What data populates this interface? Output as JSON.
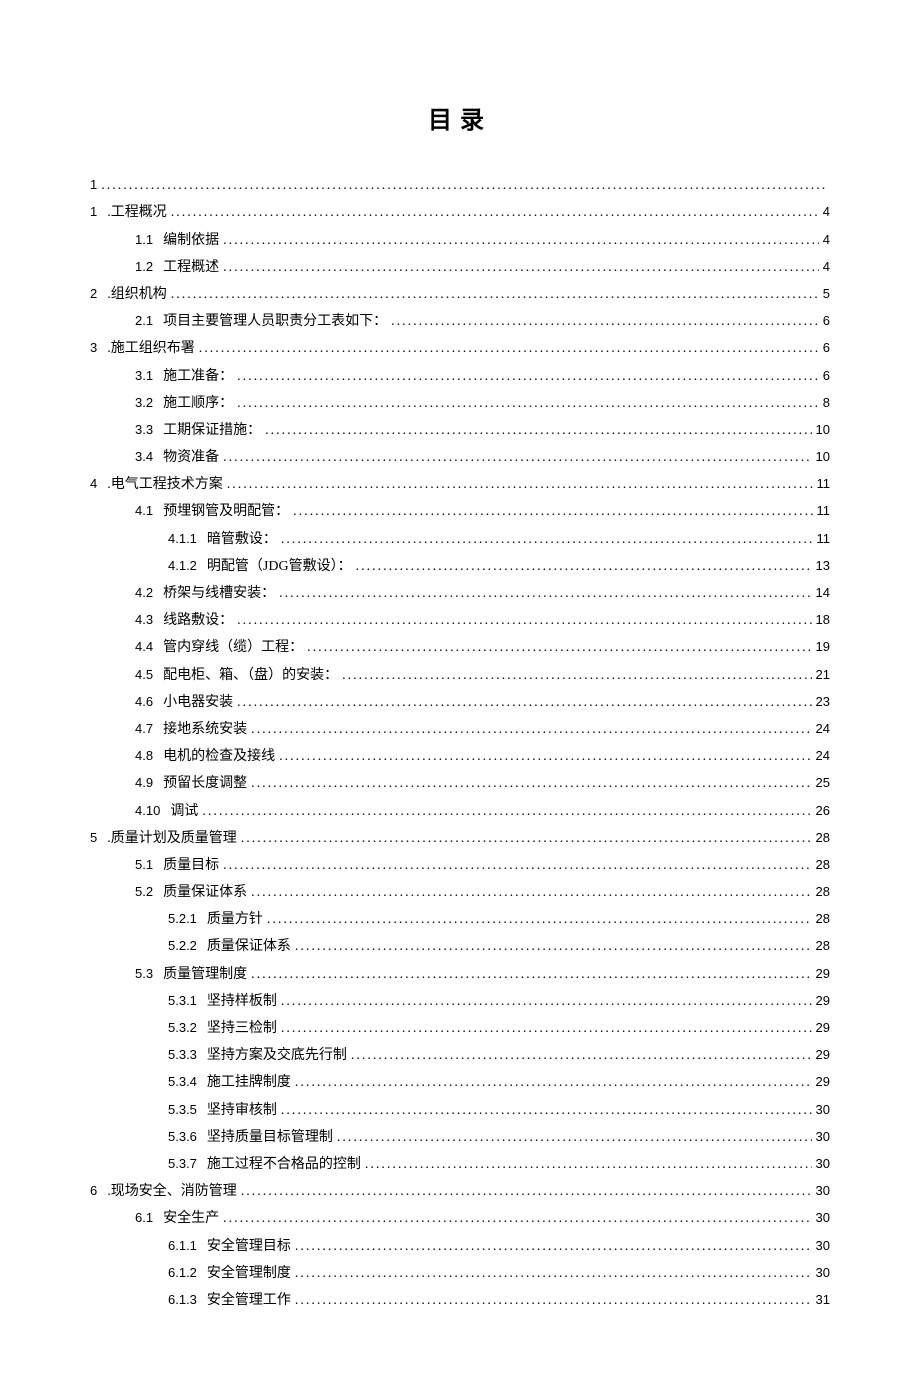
{
  "title": "目录",
  "entries": [
    {
      "indent": 0,
      "num": "1",
      "text": "",
      "page": ""
    },
    {
      "indent": 0,
      "num": "1",
      "text": ".工程概况",
      "page": "4"
    },
    {
      "indent": 1,
      "num": "1.1",
      "text": "编制依据",
      "page": "4"
    },
    {
      "indent": 1,
      "num": "1.2",
      "text": "工程概述",
      "page": "4"
    },
    {
      "indent": 0,
      "num": "2",
      "text": ".组织机构",
      "page": "5"
    },
    {
      "indent": 1,
      "num": "2.1",
      "text": "项目主要管理人员职责分工表如下：",
      "page": "6"
    },
    {
      "indent": 0,
      "num": "3",
      "text": ".施工组织布署",
      "page": "6"
    },
    {
      "indent": 1,
      "num": "3.1",
      "text": "施工准备：",
      "page": "6"
    },
    {
      "indent": 1,
      "num": "3.2",
      "text": "施工顺序：",
      "page": "8"
    },
    {
      "indent": 1,
      "num": "3.3",
      "text": "工期保证措施：",
      "page": "10"
    },
    {
      "indent": 1,
      "num": "3.4",
      "text": "物资准备",
      "page": "10"
    },
    {
      "indent": 0,
      "num": "4",
      "text": ".电气工程技术方案",
      "page": "11"
    },
    {
      "indent": 1,
      "num": "4.1",
      "text": "预埋钢管及明配管：",
      "page": "11"
    },
    {
      "indent": 2,
      "num": "4.1.1",
      "text": "暗管敷设：",
      "page": "11"
    },
    {
      "indent": 2,
      "num": "4.1.2",
      "text": "明配管（JDG管敷设）：",
      "page": "13"
    },
    {
      "indent": 1,
      "num": "4.2",
      "text": "桥架与线槽安装：",
      "page": "14"
    },
    {
      "indent": 1,
      "num": "4.3",
      "text": "线路敷设：",
      "page": "18"
    },
    {
      "indent": 1,
      "num": "4.4",
      "text": "管内穿线（缆）工程：",
      "page": "19"
    },
    {
      "indent": 1,
      "num": "4.5",
      "text": "配电柜、箱、（盘）的安装：",
      "page": "21"
    },
    {
      "indent": 1,
      "num": "4.6",
      "text": "小电器安装",
      "page": "23"
    },
    {
      "indent": 1,
      "num": "4.7",
      "text": "接地系统安装",
      "page": "24"
    },
    {
      "indent": 1,
      "num": "4.8",
      "text": "电机的检查及接线",
      "page": "24"
    },
    {
      "indent": 1,
      "num": "4.9",
      "text": "预留长度调整",
      "page": "25"
    },
    {
      "indent": 1,
      "num": "4.10",
      "text": "调试",
      "page": "26"
    },
    {
      "indent": 0,
      "num": "5",
      "text": ".质量计划及质量管理",
      "page": "28"
    },
    {
      "indent": 1,
      "num": "5.1",
      "text": "质量目标",
      "page": "28"
    },
    {
      "indent": 1,
      "num": "5.2",
      "text": "质量保证体系",
      "page": "28"
    },
    {
      "indent": 2,
      "num": "5.2.1",
      "text": "质量方针",
      "page": "28"
    },
    {
      "indent": 2,
      "num": "5.2.2",
      "text": "质量保证体系",
      "page": "28"
    },
    {
      "indent": 1,
      "num": "5.3",
      "text": "质量管理制度",
      "page": "29"
    },
    {
      "indent": 2,
      "num": "5.3.1",
      "text": "坚持样板制",
      "page": "29"
    },
    {
      "indent": 2,
      "num": "5.3.2",
      "text": "坚持三检制",
      "page": "29"
    },
    {
      "indent": 2,
      "num": "5.3.3",
      "text": "坚持方案及交底先行制",
      "page": "29"
    },
    {
      "indent": 2,
      "num": "5.3.4",
      "text": "施工挂牌制度",
      "page": "29"
    },
    {
      "indent": 2,
      "num": "5.3.5",
      "text": "坚持审核制",
      "page": "30"
    },
    {
      "indent": 2,
      "num": "5.3.6",
      "text": "坚持质量目标管理制",
      "page": "30"
    },
    {
      "indent": 2,
      "num": "5.3.7",
      "text": "施工过程不合格品的控制",
      "page": "30"
    },
    {
      "indent": 0,
      "num": "6",
      "text": ".现场安全、消防管理",
      "page": "30"
    },
    {
      "indent": 1,
      "num": "6.1",
      "text": "安全生产",
      "page": "30"
    },
    {
      "indent": 2,
      "num": "6.1.1",
      "text": "安全管理目标",
      "page": "30"
    },
    {
      "indent": 2,
      "num": "6.1.2",
      "text": "安全管理制度",
      "page": "30"
    },
    {
      "indent": 2,
      "num": "6.1.3",
      "text": "安全管理工作",
      "page": "31"
    }
  ]
}
